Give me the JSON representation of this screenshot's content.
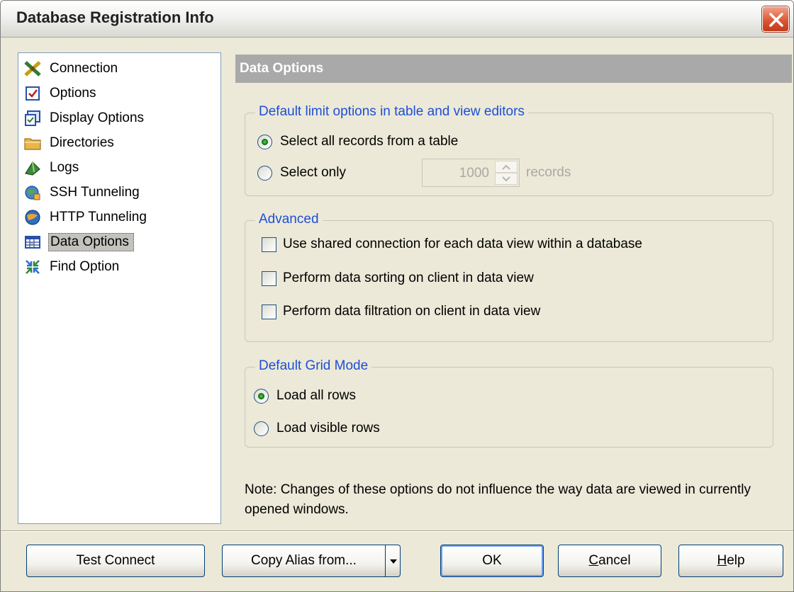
{
  "window": {
    "title": "Database Registration Info"
  },
  "nav": {
    "items": [
      {
        "label": "Connection",
        "icon": "connection-icon"
      },
      {
        "label": "Options",
        "icon": "options-icon"
      },
      {
        "label": "Display Options",
        "icon": "display-options-icon"
      },
      {
        "label": "Directories",
        "icon": "folder-icon"
      },
      {
        "label": "Logs",
        "icon": "logs-icon"
      },
      {
        "label": "SSH Tunneling",
        "icon": "ssh-tunneling-icon"
      },
      {
        "label": "HTTP Tunneling",
        "icon": "http-tunneling-icon"
      },
      {
        "label": "Data Options",
        "icon": "data-grid-icon",
        "selected": true
      },
      {
        "label": "Find Option",
        "icon": "find-option-icon"
      }
    ]
  },
  "section": {
    "title": "Data Options"
  },
  "limit_group": {
    "legend": "Default limit options in table and view editors",
    "select_all_label": "Select all records from a table",
    "select_all_checked": true,
    "select_only_label": "Select only",
    "select_only_checked": false,
    "limit_value": "1000",
    "records_label": "records"
  },
  "advanced_group": {
    "legend": "Advanced",
    "shared_connection_label": "Use shared connection for each data view within a database",
    "client_sorting_label": "Perform data sorting on client in data view",
    "client_filtration_label": "Perform data filtration on client in data view"
  },
  "grid_group": {
    "legend": "Default Grid Mode",
    "load_all_label": "Load all rows",
    "load_all_checked": true,
    "load_visible_label": "Load visible rows"
  },
  "note": "Note: Changes of these options do not influence the way data are viewed in currently opened windows.",
  "buttons": {
    "test_connect": "Test Connect",
    "copy_alias": "Copy Alias from...",
    "ok": "OK",
    "cancel_first": "C",
    "cancel_rest": "ancel",
    "help_first": "H",
    "help_rest": "elp"
  },
  "colors": {
    "legend_blue": "#1d4fd6",
    "section_header_bg": "#a9a9a9",
    "window_bg": "#ece9d8"
  }
}
